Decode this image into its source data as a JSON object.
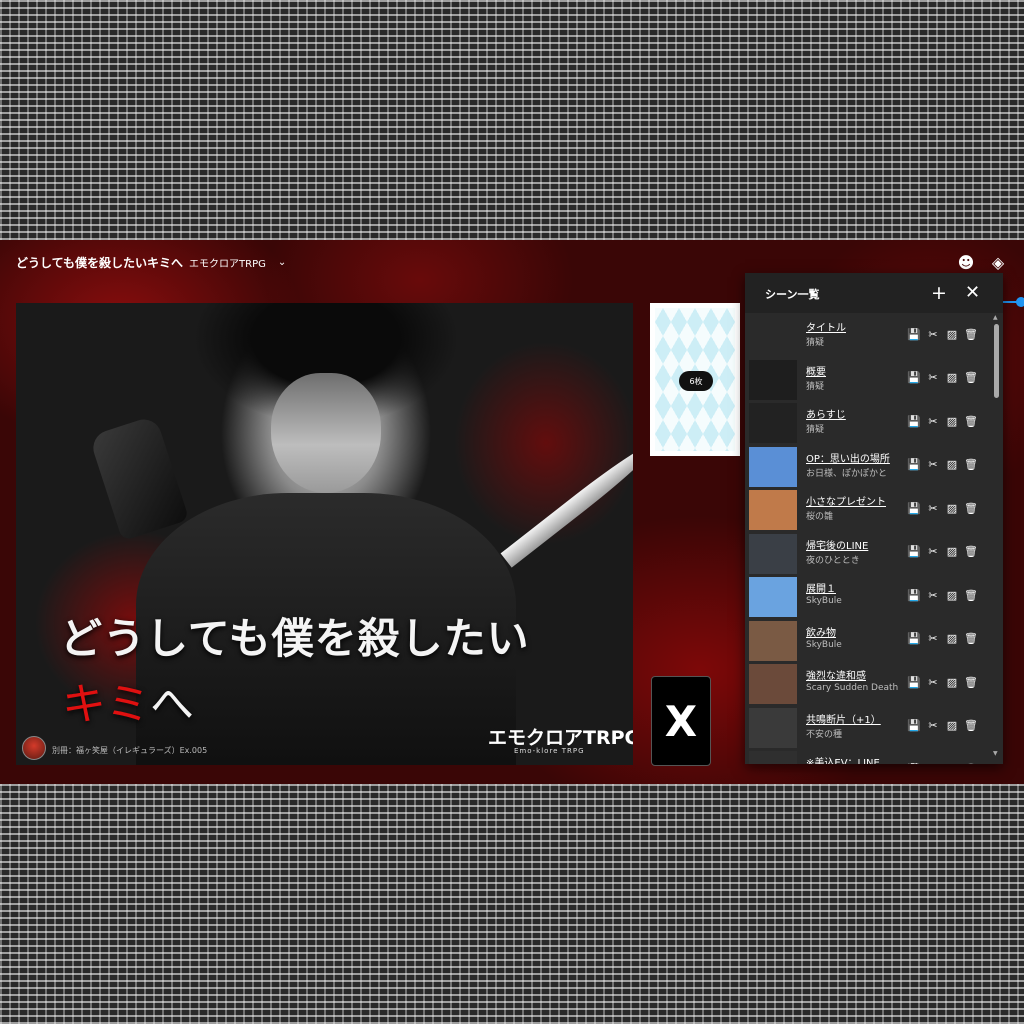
{
  "room": {
    "title": "どうしても僕を殺したいキミへ",
    "system": "エモクロアTRPG",
    "chevron": "⌄"
  },
  "toolbar": {
    "avatar_icon": "☻",
    "layers_icon": "◈"
  },
  "cover": {
    "title_line1": "どうしても僕を殺したい",
    "title_line2_red": "キミ",
    "title_line2_white": "へ",
    "logo": "エモクロアTRPG",
    "logo_sub": "Emo-klore TRPG",
    "credit": "別冊：福ヶ笑屋（イレギュラーズ）Ex.005"
  },
  "deck": {
    "count_label": "6枚"
  },
  "x_card": {
    "label": "X"
  },
  "scene_panel": {
    "title": "シーン一覧",
    "add_icon": "+",
    "close_icon": "✕",
    "scenes": [
      {
        "name": "タイトル",
        "bg": "猜疑",
        "thumb": "#2a2a2a"
      },
      {
        "name": "概要",
        "bg": "猜疑",
        "thumb": "#1e1e1e"
      },
      {
        "name": "あらすじ",
        "bg": "猜疑",
        "thumb": "#222222"
      },
      {
        "name": "OP：思い出の場所",
        "bg": "お日様、ぽかぽかと",
        "thumb": "#5a8fd6"
      },
      {
        "name": "小さなプレゼント",
        "bg": "桜の雛",
        "thumb": "#c07a4a"
      },
      {
        "name": "帰宅後のLINE",
        "bg": "夜のひととき",
        "thumb": "#3a3f46"
      },
      {
        "name": "展開１",
        "bg": "SkyBule",
        "thumb": "#6aa3e0"
      },
      {
        "name": "飲み物",
        "bg": "SkyBule",
        "thumb": "#7a5a44"
      },
      {
        "name": "強烈な違和感",
        "bg": "Scary Sudden Death",
        "thumb": "#6b4a3a"
      },
      {
        "name": "共鳴断片（+1）",
        "bg": "不安の種",
        "thumb": "#3a3a3a"
      },
      {
        "name": "※美込EV：LINE",
        "bg": "",
        "thumb": "#2f2f2f"
      }
    ],
    "row_icons": {
      "save": "💾",
      "cut": "✂",
      "hide": "▨",
      "delete": "🗑"
    }
  }
}
